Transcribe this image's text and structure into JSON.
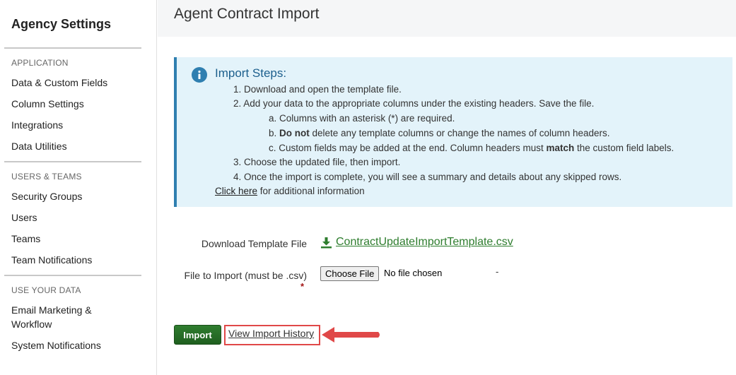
{
  "sidebar": {
    "title": "Agency Settings",
    "sections": [
      {
        "label": "APPLICATION",
        "items": [
          "Data & Custom Fields",
          "Column Settings",
          "Integrations",
          "Data Utilities"
        ]
      },
      {
        "label": "USERS & TEAMS",
        "items": [
          "Security Groups",
          "Users",
          "Teams",
          "Team Notifications"
        ]
      },
      {
        "label": "USE YOUR DATA",
        "items": [
          "Email Marketing &",
          "Workflow",
          "System Notifications"
        ]
      }
    ]
  },
  "page": {
    "title": "Agent Contract Import"
  },
  "info": {
    "heading": "Import Steps:",
    "step1": "1. Download and open the template file.",
    "step2": "2. Add your data to the appropriate columns under the existing headers. Save the file.",
    "step2a": "a. Columns with an asterisk (*) are required.",
    "step2b_pre": "b. ",
    "step2b_bold": "Do not",
    "step2b_post": " delete any template columns or change the names of column headers.",
    "step2c_pre": "c. Custom fields may be added at the end. Column headers must ",
    "step2c_bold": "match",
    "step2c_post": " the custom field labels.",
    "step3": "3. Choose the updated file, then import.",
    "step4": "4. Once the import is complete, you will see a summary and details about any skipped rows.",
    "click_here": "Click here",
    "additional": " for additional information"
  },
  "form": {
    "download_label": "Download Template File",
    "download_file": "ContractUpdateImportTemplate.csv",
    "file_label": "File to Import (must be .csv)",
    "required_mark": "*",
    "choose_file": "Choose File",
    "no_file": "No file chosen",
    "dash": "-"
  },
  "actions": {
    "import_label": "Import",
    "history_label": "View Import History"
  },
  "colors": {
    "accent": "#2f7fb0",
    "primary_button": "#2f7d2f",
    "highlight": "#e04848"
  },
  "icons": {
    "info": "info-icon",
    "download": "download-icon",
    "arrow": "arrow-left-icon"
  }
}
